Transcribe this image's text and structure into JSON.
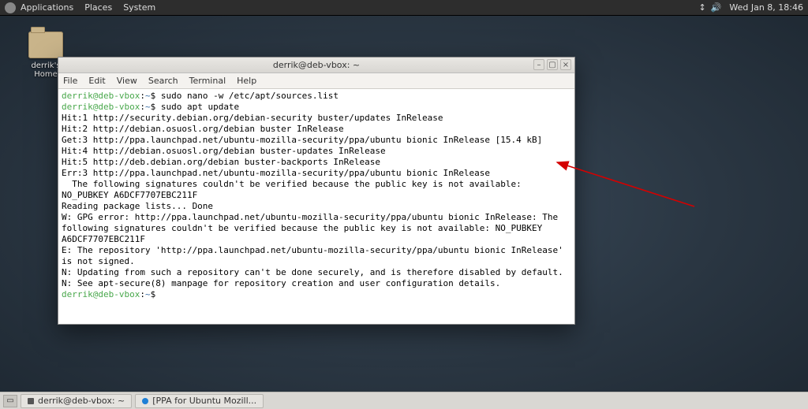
{
  "top_panel": {
    "menus": {
      "applications": "Applications",
      "places": "Places",
      "system": "System"
    },
    "clock": "Wed Jan  8, 18:46"
  },
  "desktop": {
    "home_label": "derrik's Home"
  },
  "window": {
    "title": "derrik@deb-vbox: ~",
    "menubar": {
      "file": "File",
      "edit": "Edit",
      "view": "View",
      "search": "Search",
      "terminal": "Terminal",
      "help": "Help"
    }
  },
  "prompt": {
    "user": "derrik@deb-vbox",
    "sep": ":",
    "path": "~",
    "sym": "$"
  },
  "term": {
    "cmd1": "sudo nano -w /etc/apt/sources.list",
    "cmd2": "sudo apt update",
    "l01": "Hit:1 http://security.debian.org/debian-security buster/updates InRelease",
    "l02": "Hit:2 http://debian.osuosl.org/debian buster InRelease",
    "l03": "Get:3 http://ppa.launchpad.net/ubuntu-mozilla-security/ppa/ubuntu bionic InRelease [15.4 kB]",
    "l04": "Hit:4 http://debian.osuosl.org/debian buster-updates InRelease",
    "l05": "Hit:5 http://deb.debian.org/debian buster-backports InRelease",
    "l06": "Err:3 http://ppa.launchpad.net/ubuntu-mozilla-security/ppa/ubuntu bionic InRelease",
    "l07": "  The following signatures couldn't be verified because the public key is not available: NO_PUBKEY A6DCF7707EBC211F",
    "l08": "Reading package lists... Done",
    "l09": "W: GPG error: http://ppa.launchpad.net/ubuntu-mozilla-security/ppa/ubuntu bionic InRelease: The following signatures couldn't be verified because the public key is not available: NO_PUBKEY A6DCF7707EBC211F",
    "l10": "E: The repository 'http://ppa.launchpad.net/ubuntu-mozilla-security/ppa/ubuntu bionic InRelease' is not signed.",
    "l11": "N: Updating from such a repository can't be done securely, and is therefore disabled by default.",
    "l12": "N: See apt-secure(8) manpage for repository creation and user configuration details."
  },
  "taskbar": {
    "task1": "derrik@deb-vbox: ~",
    "task2": "[PPA for Ubuntu Mozill..."
  }
}
